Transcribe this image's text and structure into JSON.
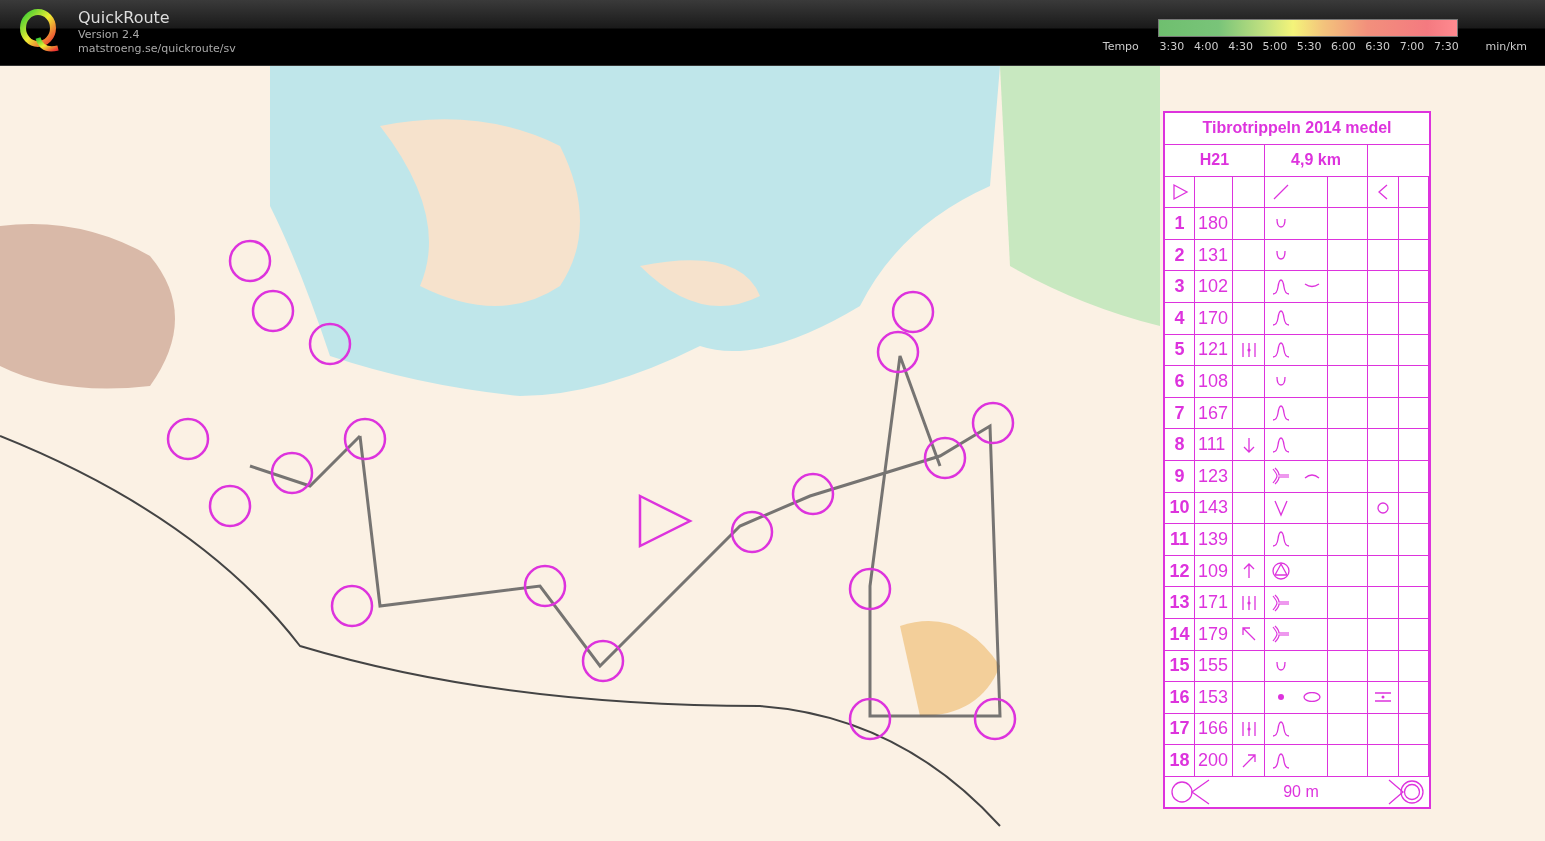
{
  "app": {
    "name": "QuickRoute",
    "version": "Version 2.4",
    "url": "matstroeng.se/quickroute/sv"
  },
  "legend": {
    "label": "Tempo",
    "ticks": [
      "3:30",
      "4:00",
      "4:30",
      "5:00",
      "5:30",
      "6:00",
      "6:30",
      "7:00",
      "7:30"
    ],
    "unit": "min/km"
  },
  "description_sheet": {
    "title": "Tibrotrippeln 2014 medel",
    "class": "H21",
    "length": "4,9 km",
    "start_row": {
      "a": {
        "kind": "start-triangle"
      },
      "d": {
        "kind": "slash"
      },
      "g": {
        "kind": "angle"
      }
    },
    "controls": [
      {
        "number": "1",
        "code": "180",
        "d": {
          "kind": "depression"
        }
      },
      {
        "number": "2",
        "code": "131",
        "d": {
          "kind": "depression"
        }
      },
      {
        "number": "3",
        "code": "102",
        "d": {
          "kind": "knoll"
        },
        "e": {
          "kind": "arc-down"
        }
      },
      {
        "number": "4",
        "code": "170",
        "d": {
          "kind": "knoll"
        }
      },
      {
        "number": "5",
        "code": "121",
        "c": {
          "kind": "between"
        },
        "d": {
          "kind": "knoll"
        }
      },
      {
        "number": "6",
        "code": "108",
        "d": {
          "kind": "depression"
        }
      },
      {
        "number": "7",
        "code": "167",
        "d": {
          "kind": "knoll"
        }
      },
      {
        "number": "8",
        "code": "111",
        "c": {
          "kind": "arrow-down"
        },
        "d": {
          "kind": "knoll"
        }
      },
      {
        "number": "9",
        "code": "123",
        "d": {
          "kind": "spur"
        },
        "e": {
          "kind": "arc-up"
        }
      },
      {
        "number": "10",
        "code": "143",
        "d": {
          "kind": "vee"
        },
        "g": {
          "kind": "ring"
        }
      },
      {
        "number": "11",
        "code": "139",
        "d": {
          "kind": "knoll"
        }
      },
      {
        "number": "12",
        "code": "109",
        "c": {
          "kind": "arrow-up"
        },
        "d": {
          "kind": "triangle-circle"
        }
      },
      {
        "number": "13",
        "code": "171",
        "c": {
          "kind": "between"
        },
        "d": {
          "kind": "spur"
        }
      },
      {
        "number": "14",
        "code": "179",
        "c": {
          "kind": "arrow-nw"
        },
        "d": {
          "kind": "spur"
        }
      },
      {
        "number": "15",
        "code": "155",
        "d": {
          "kind": "depression"
        }
      },
      {
        "number": "16",
        "code": "153",
        "d": {
          "kind": "dot"
        },
        "e": {
          "kind": "oval"
        },
        "g": {
          "kind": "dot-bars"
        }
      },
      {
        "number": "17",
        "code": "166",
        "c": {
          "kind": "between"
        },
        "d": {
          "kind": "knoll"
        }
      },
      {
        "number": "18",
        "code": "200",
        "c": {
          "kind": "arrow-ne"
        },
        "d": {
          "kind": "knoll"
        }
      }
    ],
    "finish": {
      "distance": "90 m"
    }
  }
}
